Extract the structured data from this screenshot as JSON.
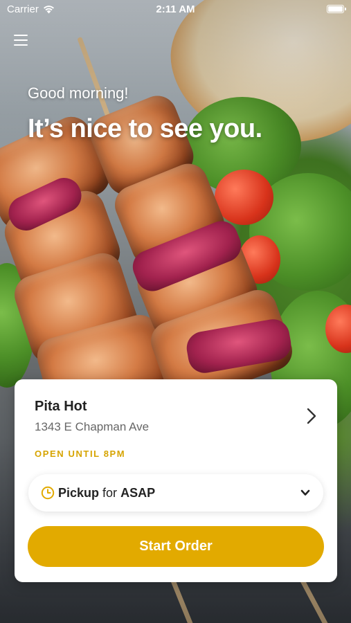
{
  "status_bar": {
    "carrier": "Carrier",
    "time": "2:11 AM"
  },
  "header": {
    "greeting": "Good morning!",
    "headline": "It’s nice to see you."
  },
  "store": {
    "name": "Pita Hot",
    "address": "1343 E Chapman Ave",
    "hours": "OPEN UNTIL 8PM"
  },
  "order_mode": {
    "mode": "Pickup",
    "connector": "for",
    "time": "ASAP"
  },
  "actions": {
    "start_order_label": "Start Order"
  },
  "icons": {
    "menu": "hamburger-menu-icon",
    "wifi": "wifi-icon",
    "battery": "battery-icon",
    "store_detail": "chevron-right-icon",
    "pickup_time": "clock-icon",
    "order_mode_dropdown": "chevron-down-icon"
  },
  "colors": {
    "accent": "#e2aa00",
    "hours_text": "#d6a400",
    "card_background": "#ffffff",
    "primary_text": "#222222",
    "secondary_text": "#666666"
  }
}
